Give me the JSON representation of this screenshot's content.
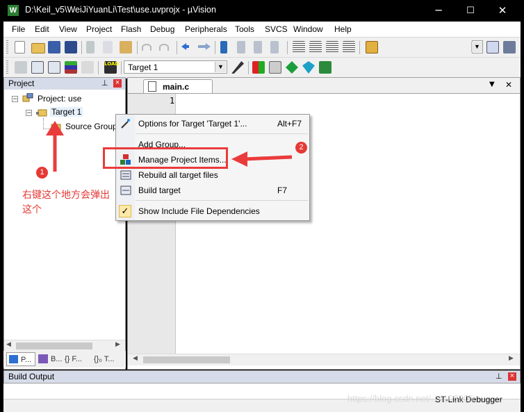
{
  "window": {
    "title": "D:\\Keil_v5\\WeiJiYuanLi\\Test\\use.uvprojx - µVision",
    "app_icon": "W",
    "controls": {
      "minimize": "─",
      "maximize": "☐",
      "close": "✕"
    }
  },
  "menubar": [
    "File",
    "Edit",
    "View",
    "Project",
    "Flash",
    "Debug",
    "Peripherals",
    "Tools",
    "SVCS",
    "Window",
    "Help"
  ],
  "toolbar2": {
    "target_select": "Target 1"
  },
  "project_panel": {
    "title": "Project",
    "pin": "⌂",
    "close": "×",
    "tree": {
      "root": "Project: use",
      "target": "Target 1",
      "group": "Source Group"
    },
    "tabs": [
      "P...",
      "B...",
      "{} F...",
      "{}₀ T..."
    ]
  },
  "editor": {
    "tab": "main.c",
    "line_numbers": [
      "1"
    ],
    "tab_menu": "▼",
    "tab_close": "✕"
  },
  "context_menu": {
    "items": [
      {
        "label": "Options for Target 'Target 1'...",
        "shortcut": "Alt+F7",
        "icon": "magic-wand-icon"
      },
      {
        "label": "Add Group...",
        "shortcut": "",
        "icon": ""
      },
      {
        "label": "Manage Project Items...",
        "shortcut": "",
        "icon": "components-icon"
      },
      {
        "label": "Rebuild all target files",
        "shortcut": "",
        "icon": "rebuild-icon"
      },
      {
        "label": "Build target",
        "shortcut": "F7",
        "icon": "build-icon"
      },
      {
        "label": "Show Include File Dependencies",
        "shortcut": "",
        "icon": "checkmark-icon"
      }
    ]
  },
  "build_output": {
    "title": "Build Output",
    "pin": "⌂",
    "close": "×"
  },
  "status": {
    "debugger": "ST-Link Debugger"
  },
  "annotations": {
    "badge1": "1",
    "badge2": "2",
    "note": "右键这个地方会弹出这个",
    "color": "#e53935"
  },
  "watermark": "https://blog.csdn.net/...4103205"
}
